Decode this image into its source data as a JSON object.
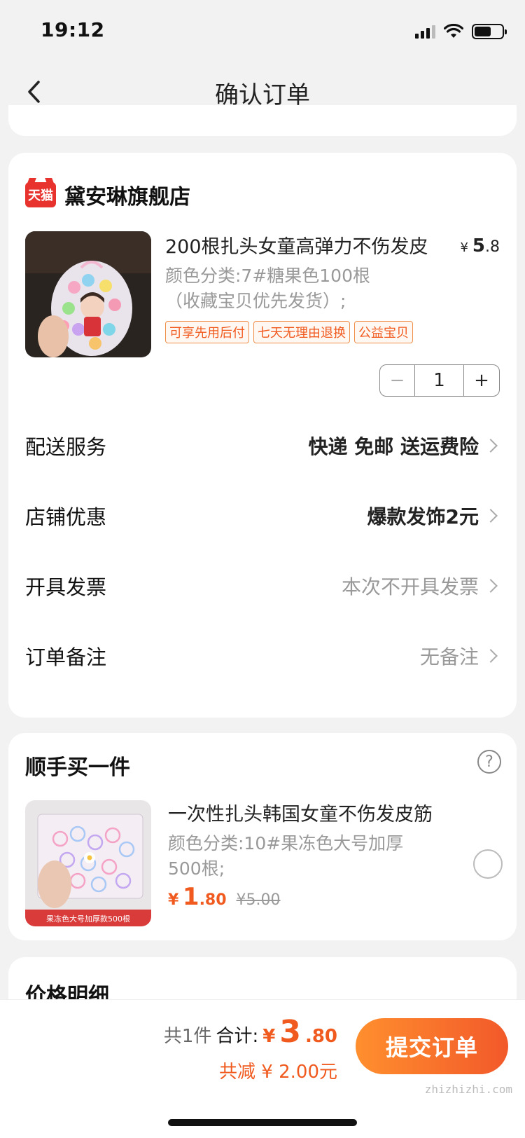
{
  "status_bar": {
    "time": "19:12",
    "battery_level": 0.6
  },
  "nav": {
    "title": "确认订单"
  },
  "shop": {
    "badge": "天猫",
    "name": "黛安琳旗舰店",
    "product": {
      "title": "200根扎头女童高弹力不伤发皮",
      "price_yen": "¥",
      "price_int": "5",
      "price_dec": ".8",
      "sku": "颜色分类:7#糖果色100根（收藏宝贝优先发货）;",
      "tags": [
        "可享先用后付",
        "七天无理由退换",
        "公益宝贝"
      ],
      "quantity": "1",
      "minus": "−",
      "plus": "+"
    },
    "rows": [
      {
        "label": "配送服务",
        "value": "快递 免邮 送运费险"
      },
      {
        "label": "店铺优惠",
        "value": "爆款发饰2元"
      },
      {
        "label": "开具发票",
        "value": "本次不开具发票"
      },
      {
        "label": "订单备注",
        "value": "无备注"
      }
    ]
  },
  "addon": {
    "title": "顺手买一件",
    "help": "?",
    "name": "一次性扎头韩国女童不伤发皮筋",
    "sku": "颜色分类:10#果冻色大号加厚500根;",
    "image_caption": "果冻色大号加厚款500根",
    "price_yen": "¥",
    "price_int": "1",
    "price_dec": ".80",
    "original_price": "¥5.00"
  },
  "detail": {
    "title": "价格明细"
  },
  "footer": {
    "count": "共1件",
    "total_label": "合计:",
    "total_yen": "¥",
    "total_int": "3",
    "total_dec": ".80",
    "discount": "共减 ¥ 2.00元",
    "submit": "提交订单",
    "watermark": "zhizhizhi.com"
  },
  "colors": {
    "accent": "#f05a1e",
    "button_start": "#ff8f2e",
    "button_end": "#f2592a",
    "tmall_red": "#e8322d"
  }
}
